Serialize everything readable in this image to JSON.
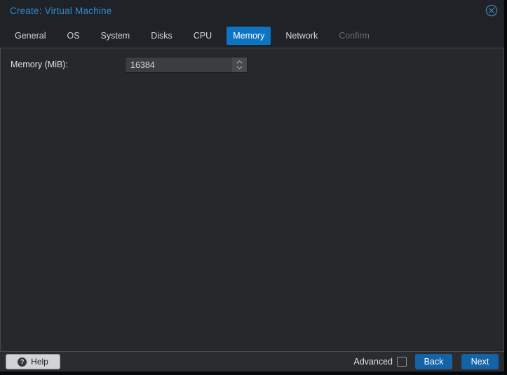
{
  "window": {
    "title": "Create: Virtual Machine"
  },
  "tabs": [
    {
      "label": "General",
      "state": "normal"
    },
    {
      "label": "OS",
      "state": "normal"
    },
    {
      "label": "System",
      "state": "normal"
    },
    {
      "label": "Disks",
      "state": "normal"
    },
    {
      "label": "CPU",
      "state": "normal"
    },
    {
      "label": "Memory",
      "state": "active"
    },
    {
      "label": "Network",
      "state": "normal"
    },
    {
      "label": "Confirm",
      "state": "disabled"
    }
  ],
  "form": {
    "memory_label": "Memory (MiB):",
    "memory_value": "16384"
  },
  "footer": {
    "help_label": "Help",
    "help_icon_glyph": "?",
    "advanced_label": "Advanced",
    "advanced_checked": false,
    "back_label": "Back",
    "next_label": "Next"
  },
  "colors": {
    "title_text": "#2d8ad4",
    "active_tab_bg": "#0d74c4",
    "button_bg": "#1463a6",
    "header_bg": "#1f2226",
    "panel_bg": "#26282b",
    "footer_bg": "#2b2c2f"
  }
}
